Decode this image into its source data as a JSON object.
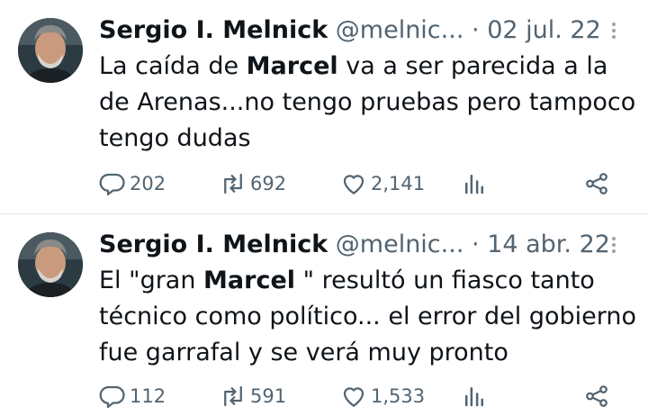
{
  "tweets": [
    {
      "author": "Sergio I. Melnick",
      "handle": "@melnic...",
      "separator": "·",
      "date": "02 jul. 22",
      "text_before": "La caída de ",
      "highlight": "Marcel",
      "text_after": " va a ser parecida a la de Arenas...no tengo pruebas pero tampoco tengo dudas",
      "replies": "202",
      "retweets": "692",
      "likes": "2,141"
    },
    {
      "author": "Sergio I. Melnick",
      "handle": "@melnic...",
      "separator": "·",
      "date": "14 abr. 22",
      "text_before": "El \"gran ",
      "highlight": "Marcel",
      "text_after": " \" resultó un fiasco tanto técnico como político... el error del gobierno fue garrafal y se verá muy pronto",
      "replies": "112",
      "retweets": "591",
      "likes": "1,533"
    }
  ],
  "icons": {
    "reply": "reply-icon",
    "retweet": "retweet-icon",
    "like": "heart-icon",
    "views": "views-icon",
    "share": "share-icon",
    "more": "more-icon"
  },
  "colors": {
    "text": "#0f1419",
    "secondary": "#536471",
    "divider": "#e1e6ea"
  }
}
